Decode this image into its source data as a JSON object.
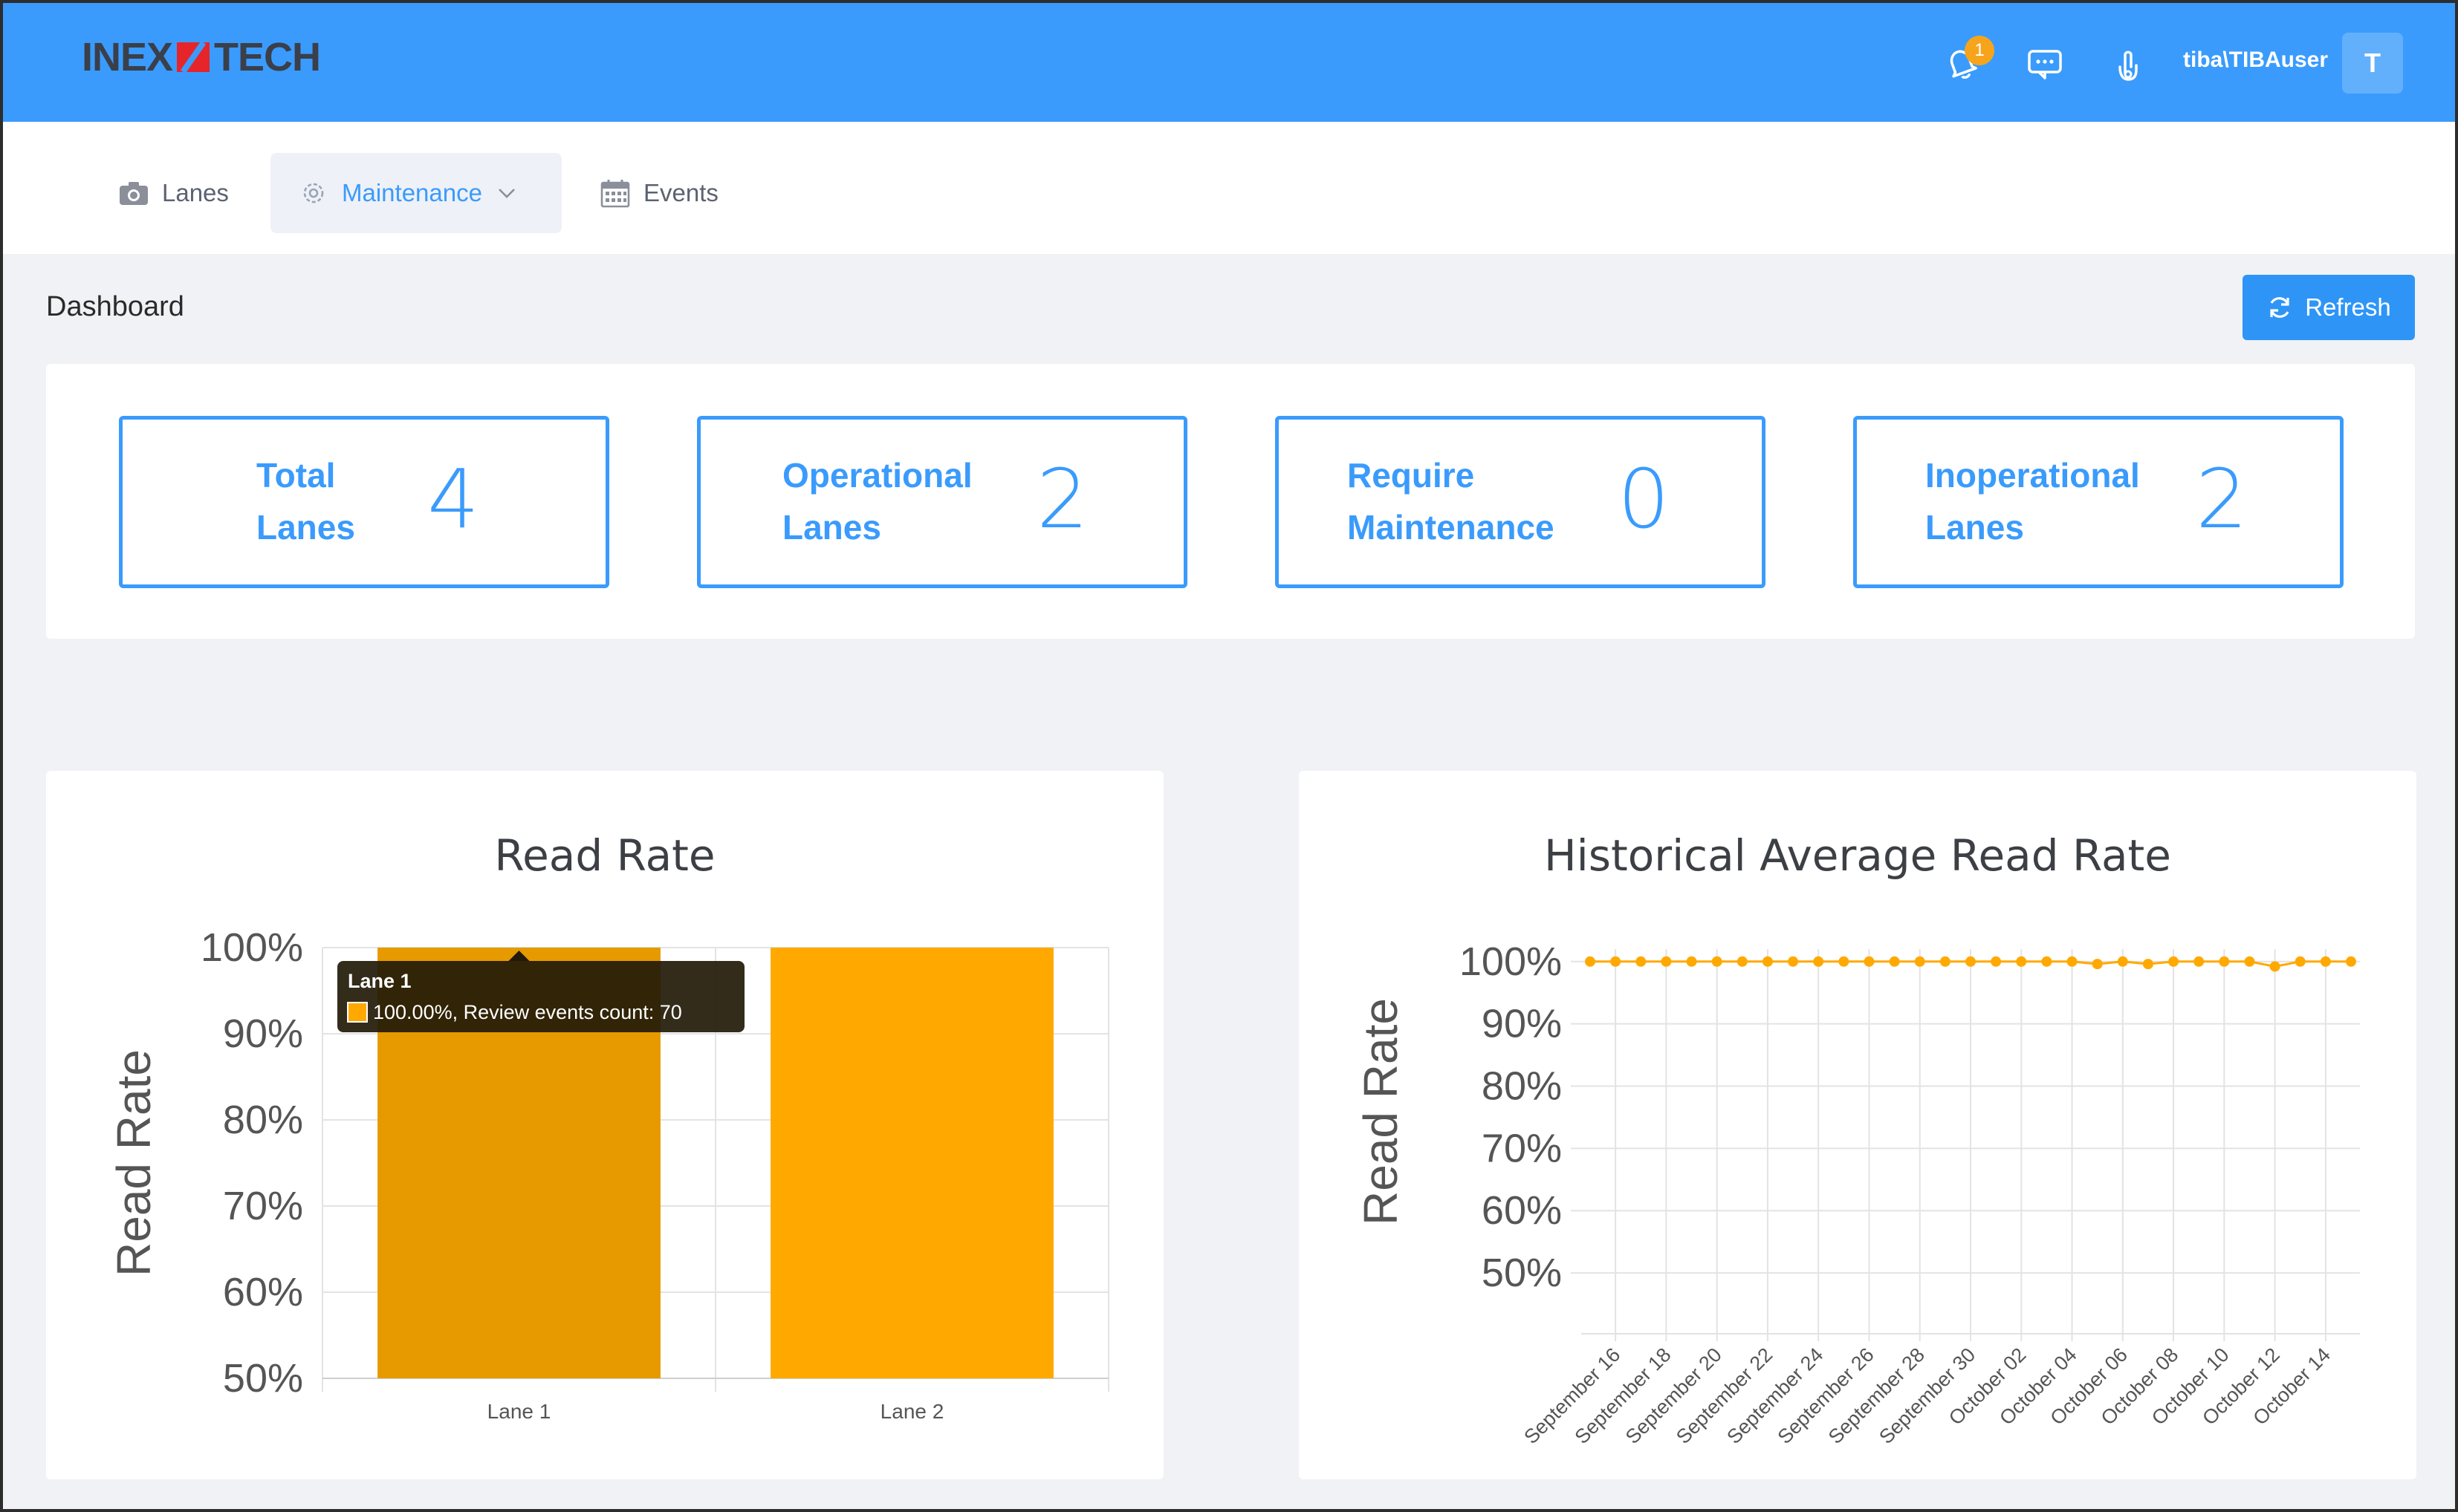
{
  "header": {
    "logo_left": "INEX",
    "logo_right": "TECH",
    "notification_count": "1",
    "username": "tiba\\TIBAuser",
    "avatar_initial": "T",
    "colors": {
      "bar": "#3a9bfc",
      "badge": "#f7a41d"
    }
  },
  "nav": {
    "items": [
      {
        "label": "Lanes",
        "icon": "camera-icon"
      },
      {
        "label": "Maintenance",
        "icon": "gear-icon",
        "active": true
      },
      {
        "label": "Events",
        "icon": "calendar-icon"
      }
    ]
  },
  "dashboard": {
    "title": "Dashboard",
    "refresh_label": "Refresh"
  },
  "stats": [
    {
      "label": "Total\nLanes",
      "value": "4"
    },
    {
      "label": "Operational\nLanes",
      "value": "2"
    },
    {
      "label": "Require\nMaintenance",
      "value": "0"
    },
    {
      "label": "Inoperational\nLanes",
      "value": "2"
    }
  ],
  "chart_data": [
    {
      "type": "bar",
      "title": "Read Rate",
      "ylabel": "Read Rate",
      "xlabel": "",
      "categories": [
        "Lane 1",
        "Lane 2"
      ],
      "values": [
        100,
        100
      ],
      "ylim": [
        50,
        100
      ],
      "yticks": [
        "100%",
        "90%",
        "80%",
        "70%",
        "60%",
        "50%"
      ],
      "grid": true,
      "bar_color": "#ffa900",
      "hover_bar_color": "#e69a00",
      "tooltip": {
        "title": "Lane 1",
        "text": "100.00%, Review events count: 70"
      }
    },
    {
      "type": "line",
      "title": "Historical Average Read Rate",
      "ylabel": "Read Rate",
      "xlabel": "",
      "x": [
        "September 15",
        "September 16",
        "September 17",
        "September 18",
        "September 19",
        "September 20",
        "September 21",
        "September 22",
        "September 23",
        "September 24",
        "September 25",
        "September 26",
        "September 27",
        "September 28",
        "September 29",
        "September 30",
        "October 01",
        "October 02",
        "October 03",
        "October 04",
        "October 05",
        "October 06",
        "October 07",
        "October 08",
        "October 09",
        "October 10",
        "October 11",
        "October 12",
        "October 13",
        "October 14",
        "October 15"
      ],
      "values": [
        100,
        100,
        100,
        100,
        100,
        100,
        100,
        100,
        100,
        100,
        100,
        100,
        100,
        100,
        100,
        100,
        100,
        100,
        100,
        100,
        99.6,
        100,
        99.6,
        100,
        100,
        100,
        100,
        99.2,
        100,
        100,
        100
      ],
      "xtick_labels": [
        "September 16",
        "September 18",
        "September 20",
        "September 22",
        "September 24",
        "September 26",
        "September 28",
        "September 30",
        "October 02",
        "October 04",
        "October 06",
        "October 08",
        "October 10",
        "October 12",
        "October 14"
      ],
      "ylim": [
        45,
        102
      ],
      "yticks": [
        "100%",
        "90%",
        "80%",
        "70%",
        "60%",
        "50%"
      ],
      "grid": true,
      "line_color": "#ffa900"
    }
  ]
}
